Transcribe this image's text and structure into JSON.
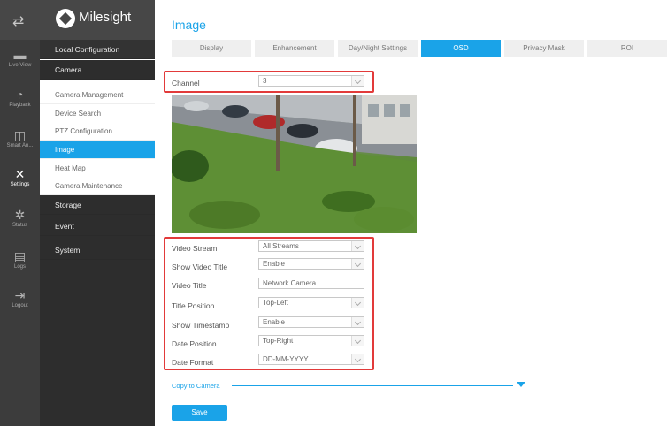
{
  "rail": [
    {
      "icon": "transfer-icon",
      "glyph": "⇄",
      "label": ""
    },
    {
      "icon": "live-view-icon",
      "glyph": "▬",
      "label": "Live View"
    },
    {
      "icon": "playback-icon",
      "glyph": "◔",
      "label": "Playback"
    },
    {
      "icon": "smart-analytics-icon",
      "glyph": "◫",
      "label": "Smart An..."
    },
    {
      "icon": "settings-icon",
      "glyph": "✕",
      "label": "Settings"
    },
    {
      "icon": "status-icon",
      "glyph": "✲",
      "label": "Status"
    },
    {
      "icon": "logs-icon",
      "glyph": "▤",
      "label": "Logs"
    },
    {
      "icon": "logout-icon",
      "glyph": "⇥",
      "label": "Logout"
    }
  ],
  "brand": {
    "name": "Milesight"
  },
  "sidebar": {
    "local": "Local Configuration",
    "camera": "Camera",
    "camera_items": [
      "Camera Management",
      "Device Search",
      "PTZ Configuration",
      "Image",
      "Heat Map",
      "Camera Maintenance"
    ],
    "storage": "Storage",
    "event": "Event",
    "system": "System"
  },
  "page": {
    "title": "Image"
  },
  "tabs": [
    "Display",
    "Enhancement",
    "Day/Night Settings",
    "OSD",
    "Privacy Mask",
    "ROI"
  ],
  "channel": {
    "label": "Channel",
    "value": "3"
  },
  "settings": [
    {
      "label": "Video Stream",
      "value": "All Streams",
      "type": "select"
    },
    {
      "label": "Show Video Title",
      "value": "Enable",
      "type": "select"
    },
    {
      "label": "Video Title",
      "value": "Network Camera",
      "type": "text"
    },
    {
      "label": "Title Position",
      "value": "Top-Left",
      "type": "select"
    },
    {
      "label": "Show Timestamp",
      "value": "Enable",
      "type": "select"
    },
    {
      "label": "Date Position",
      "value": "Top-Right",
      "type": "select"
    },
    {
      "label": "Date Format",
      "value": "DD-MM-YYYY",
      "type": "select"
    }
  ],
  "copy_label": "Copy to Camera",
  "save_label": "Save",
  "colors": {
    "accent": "#1aa3e8",
    "highlight": "#e23a3a",
    "rail": "#3c3c3c"
  }
}
